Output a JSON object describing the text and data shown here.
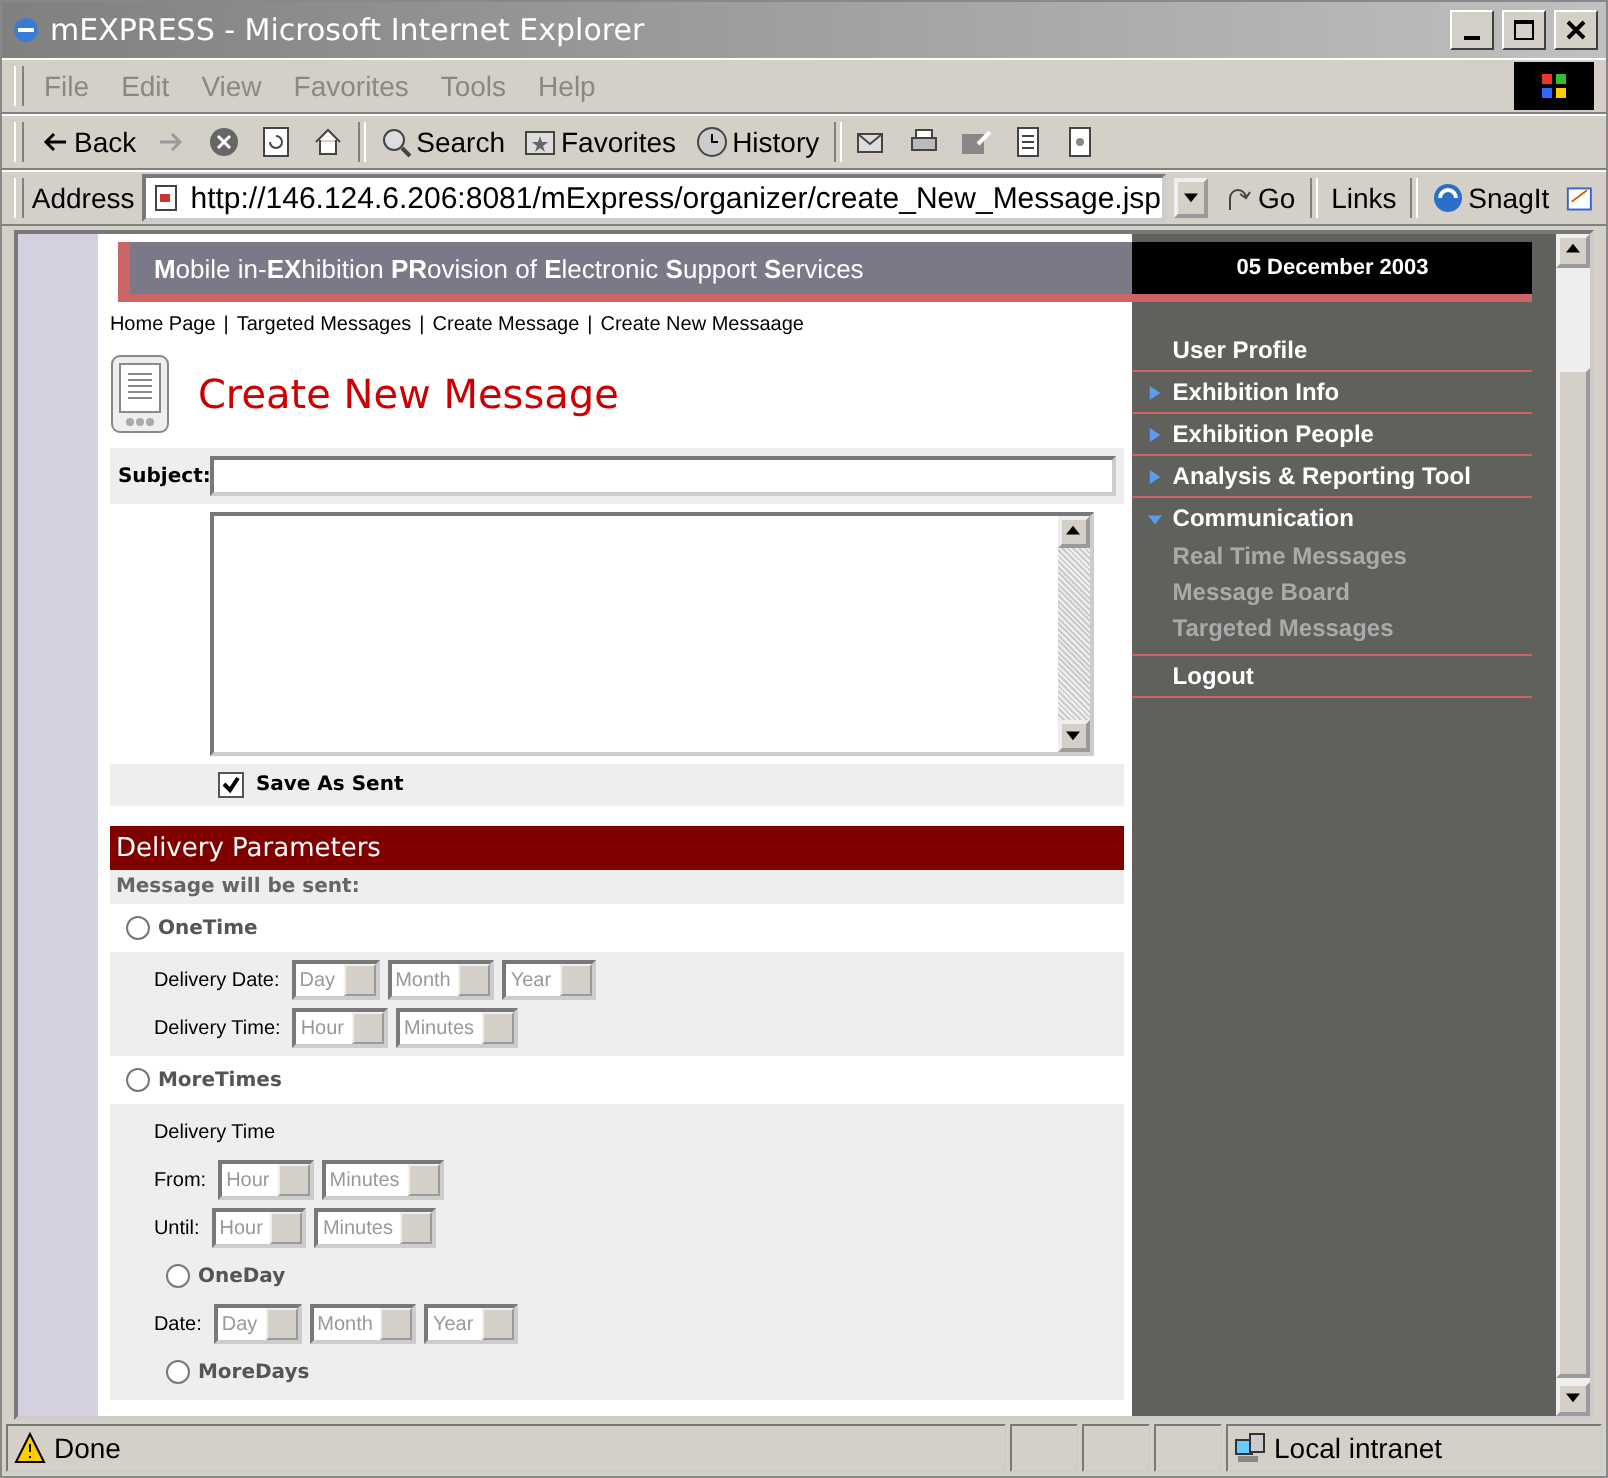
{
  "window": {
    "title": "mEXPRESS - Microsoft Internet Explorer"
  },
  "menu": [
    "File",
    "Edit",
    "View",
    "Favorites",
    "Tools",
    "Help"
  ],
  "toolbar": [
    {
      "kind": "back",
      "label": "Back"
    },
    {
      "kind": "forward"
    },
    {
      "kind": "stop"
    },
    {
      "kind": "refresh"
    },
    {
      "kind": "home"
    },
    {
      "kind": "search",
      "label": "Search"
    },
    {
      "kind": "favorites",
      "label": "Favorites"
    },
    {
      "kind": "history",
      "label": "History"
    },
    {
      "kind": "mail"
    },
    {
      "kind": "print"
    },
    {
      "kind": "edit"
    },
    {
      "kind": "discuss"
    },
    {
      "kind": "messenger"
    }
  ],
  "address": {
    "label": "Address",
    "url": "http://146.124.6.206:8081/mExpress/organizer/create_New_Message.jsp",
    "go": "Go",
    "links": "Links",
    "snagit": "SnagIt"
  },
  "banner": {
    "title": "**M**obile in-**EX**hibition **PR**ovision of **E**lectronic **S**upport **S**ervices",
    "date": "05 December 2003"
  },
  "breadcrumb": {
    "separator": "|",
    "items": [
      "Home Page",
      "Targeted Messages",
      "Create Message",
      "Create New Messaage"
    ]
  },
  "page_title": "Create New Message",
  "form": {
    "subject_label": "Subject:",
    "save_as_sent": {
      "label": "Save As Sent",
      "checked": true
    }
  },
  "delivery": {
    "title": "Delivery Parameters",
    "subtitle": "Message will be sent:",
    "one_time": {
      "label": "OneTime",
      "selected": false,
      "rows": [
        {
          "label": "Delivery Date:",
          "selects": [
            "Day",
            "Month",
            "Year"
          ]
        },
        {
          "label": "Delivery Time:",
          "selects": [
            "Hour",
            "Minutes"
          ]
        }
      ]
    },
    "more_times": {
      "label": "MoreTimes",
      "selected": false,
      "heading": "Delivery Time",
      "rows": [
        {
          "label": "From:",
          "selects": [
            "Hour",
            "Minutes"
          ]
        },
        {
          "label": "Until:",
          "selects": [
            "Hour",
            "Minutes"
          ]
        }
      ],
      "one_day": {
        "label": "OneDay",
        "selected": false,
        "rows": [
          {
            "label": "Date:",
            "selects": [
              "Day",
              "Month",
              "Year"
            ]
          }
        ]
      },
      "more_days": {
        "label": "MoreDays",
        "selected": false
      }
    }
  },
  "sidebar": [
    {
      "kind": "link",
      "label": "User Profile"
    },
    {
      "kind": "section",
      "label": "Exhibition Info",
      "expanded": false
    },
    {
      "kind": "section",
      "label": "Exhibition People",
      "expanded": false
    },
    {
      "kind": "section",
      "label": "Analysis & Reporting Tool",
      "expanded": false
    },
    {
      "kind": "section",
      "label": "Communication",
      "expanded": true,
      "children": [
        {
          "label": "Real Time Messages"
        },
        {
          "label": "Message Board"
        },
        {
          "label": "Targeted Messages"
        }
      ]
    },
    {
      "kind": "link",
      "label": "Logout"
    }
  ],
  "status_bar": {
    "text": "Done",
    "zone": "Local intranet"
  }
}
